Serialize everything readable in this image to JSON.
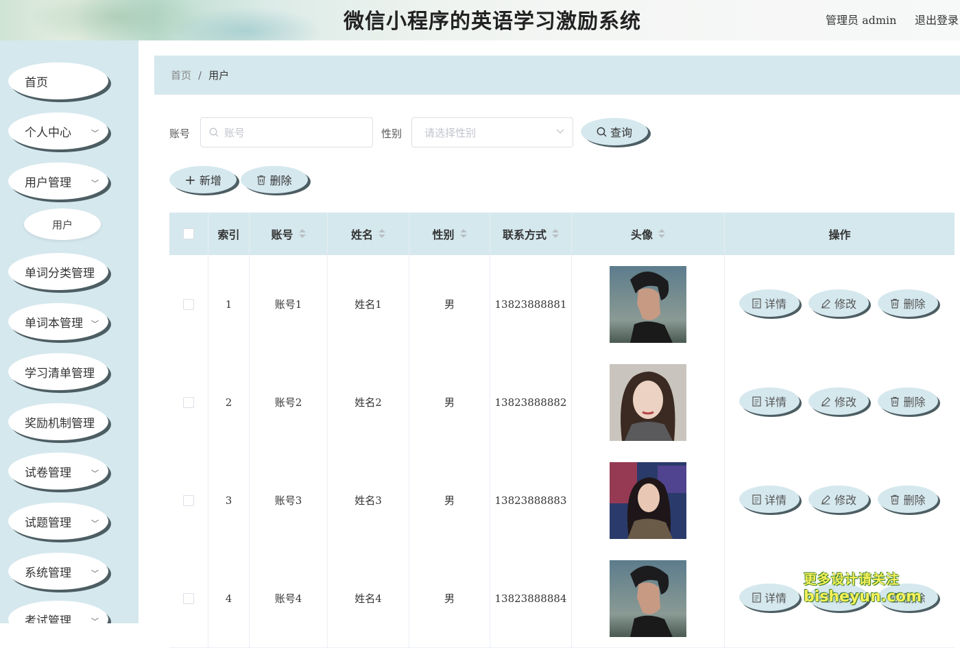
{
  "header": {
    "title": "微信小程序的英语学习激励系统",
    "user_label": "管理员 admin",
    "logout_label": "退出登录"
  },
  "sidebar": {
    "items": [
      {
        "label": "首页",
        "has_children": false
      },
      {
        "label": "个人中心",
        "has_children": true
      },
      {
        "label": "用户管理",
        "has_children": true
      },
      {
        "label": "单词分类管理",
        "has_children": true
      },
      {
        "label": "单词本管理",
        "has_children": true
      },
      {
        "label": "学习清单管理",
        "has_children": true
      },
      {
        "label": "奖励机制管理",
        "has_children": true
      },
      {
        "label": "试卷管理",
        "has_children": true
      },
      {
        "label": "试题管理",
        "has_children": true
      },
      {
        "label": "系统管理",
        "has_children": true
      },
      {
        "label": "考试管理",
        "has_children": true
      }
    ],
    "sub_item": "用户"
  },
  "breadcrumb": {
    "home": "首页",
    "separator": "/",
    "current": "用户"
  },
  "search": {
    "account_label": "账号",
    "account_placeholder": "账号",
    "gender_label": "性别",
    "gender_placeholder": "请选择性别",
    "query_button": "查询"
  },
  "actions": {
    "add_button": "新增",
    "delete_button": "删除"
  },
  "table": {
    "headers": {
      "index": "索引",
      "account": "账号",
      "name": "姓名",
      "gender": "性别",
      "phone": "联系方式",
      "avatar": "头像",
      "operation": "操作"
    },
    "row_buttons": {
      "detail": "详情",
      "edit": "修改",
      "delete": "删除"
    },
    "rows": [
      {
        "index": "1",
        "account": "账号1",
        "name": "姓名1",
        "gender": "男",
        "phone": "13823888881",
        "avatar": "male-avatar"
      },
      {
        "index": "2",
        "account": "账号2",
        "name": "姓名2",
        "gender": "男",
        "phone": "13823888882",
        "avatar": "female-avatar"
      },
      {
        "index": "3",
        "account": "账号3",
        "name": "姓名3",
        "gender": "男",
        "phone": "13823888883",
        "avatar": "female-avatar-night"
      },
      {
        "index": "4",
        "account": "账号4",
        "name": "姓名4",
        "gender": "男",
        "phone": "13823888884",
        "avatar": "male-avatar"
      }
    ]
  },
  "watermark": {
    "line1": "更多设计请关注",
    "line2": "bisheyun.com"
  },
  "colors": {
    "accent": "#d5e8ee",
    "shadow": "#4d5e63"
  }
}
